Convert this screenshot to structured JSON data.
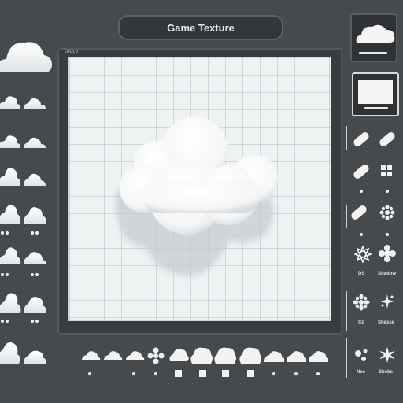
{
  "title": "Game Texture",
  "canvas": {
    "label": "l0tto"
  },
  "right_panel": {
    "labels": [
      "DS",
      "Shadow",
      "Cd",
      "Shesse",
      "Nee",
      "Sbebe"
    ]
  },
  "colors": {
    "background": "#474a4d",
    "panel": "#3a3d40",
    "grid": "#eff2f3",
    "cloud": "#ffffff"
  },
  "icons": {
    "left_tools": "cloud-icon",
    "bottom_tools": "cloud-variant-icon",
    "right_tools": [
      "pill-icon",
      "window-grid-icon",
      "flower-icon",
      "gear-flower-icon",
      "burst-icon",
      "splash-icon"
    ]
  }
}
